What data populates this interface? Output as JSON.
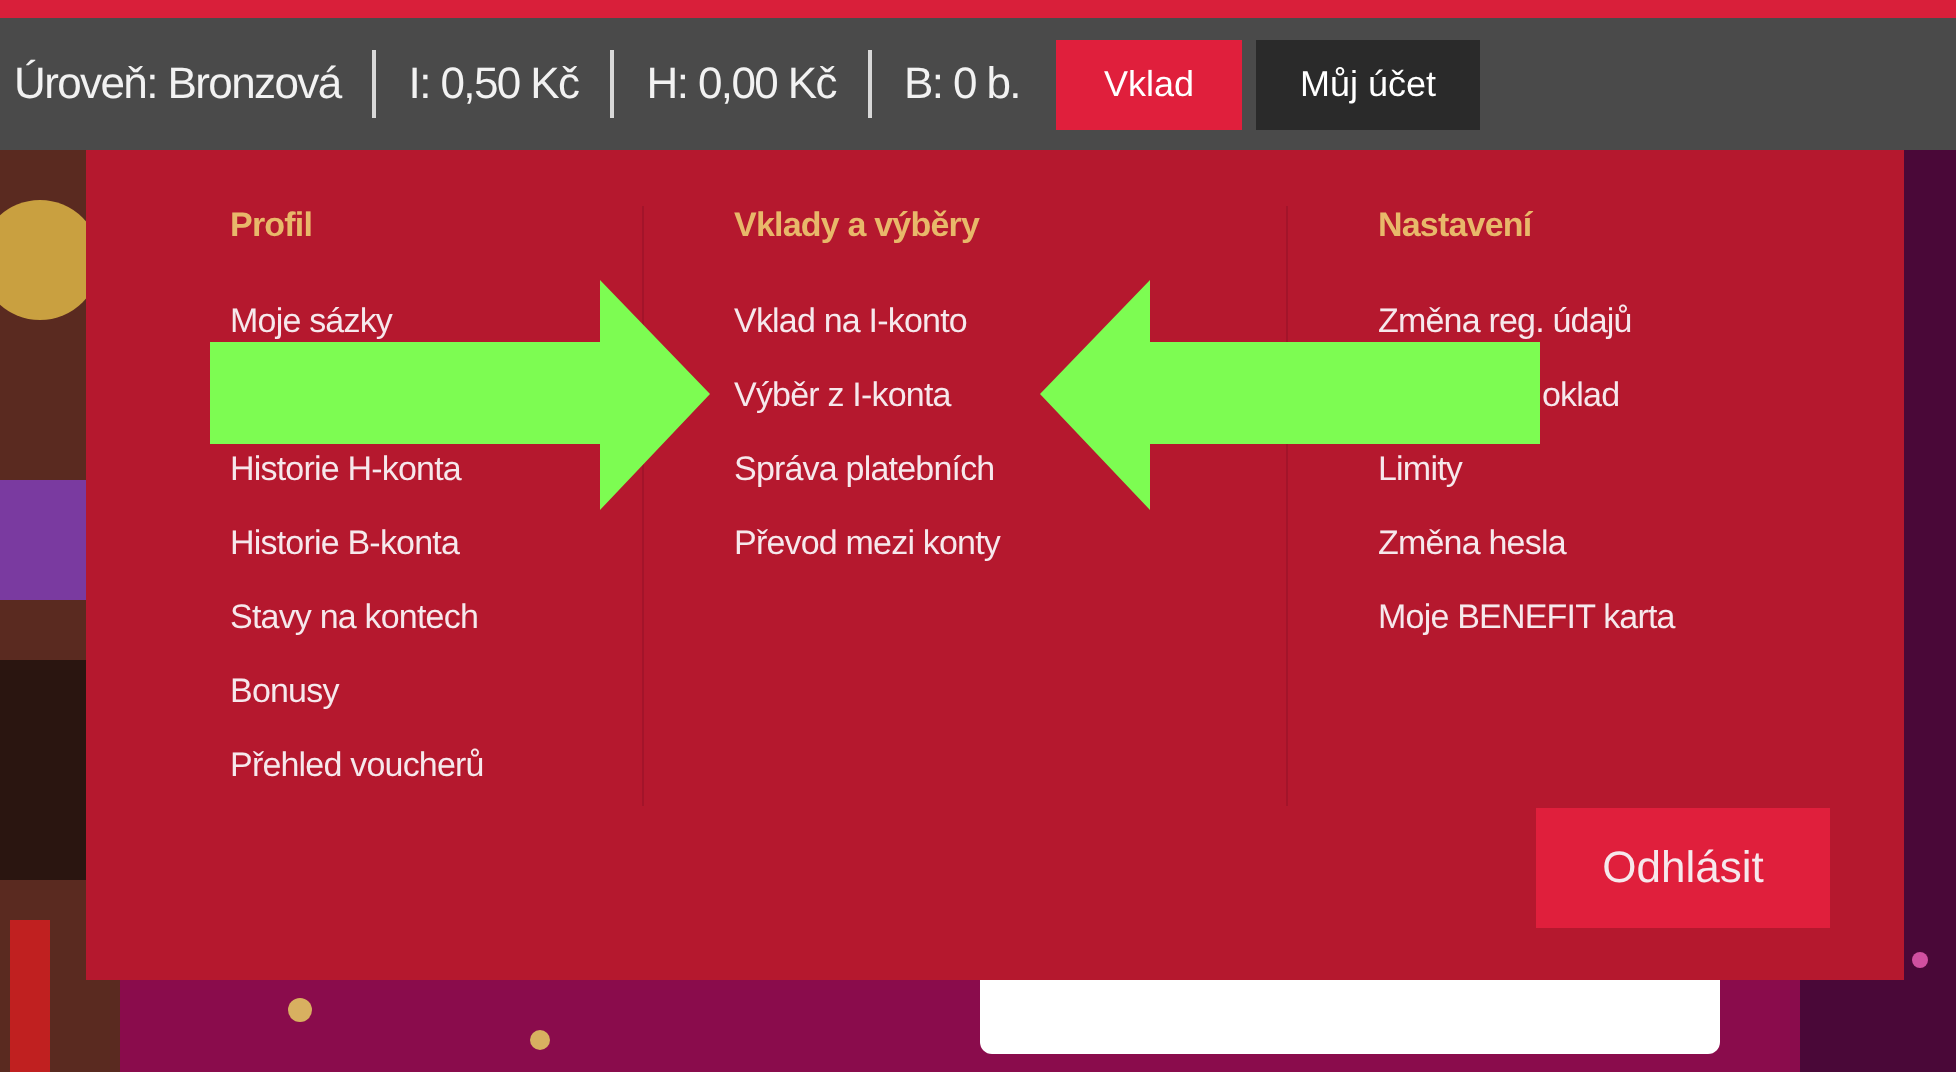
{
  "top_bar": {
    "stats": [
      {
        "text": "Úroveň: Bronzová"
      },
      {
        "text": "I: 0,50 Kč"
      },
      {
        "text": "H: 0,00 Kč"
      },
      {
        "text": "B: 0 b."
      }
    ],
    "buttons": [
      {
        "label": "Vklad",
        "kind": "primary"
      },
      {
        "label": "Můj účet",
        "kind": "dark"
      }
    ]
  },
  "account_menu": {
    "columns": [
      {
        "heading": "Profil",
        "items": [
          {
            "label": "Moje sázky"
          },
          {
            "kind": "hidden"
          },
          {
            "label": "Historie H-konta"
          },
          {
            "label": "Historie B-konta"
          },
          {
            "label": "Stavy na kontech"
          },
          {
            "label": "Bonusy"
          },
          {
            "label": "Přehled voucherů"
          }
        ]
      },
      {
        "heading": "Vklady a výběry",
        "items": [
          {
            "label": "Vklad na I-konto"
          },
          {
            "label": "Výběr z I-konta"
          },
          {
            "label": "Správa platebních"
          },
          {
            "label": "Převod mezi konty"
          }
        ]
      },
      {
        "heading": "Nastavení",
        "items": [
          {
            "label": "Změna reg. údajů"
          },
          {
            "label": "oklad",
            "kind": "partial"
          },
          {
            "label": "Limity"
          },
          {
            "label": "Změna hesla"
          },
          {
            "label": "Moje BENEFIT karta"
          }
        ]
      }
    ],
    "logout_button": {
      "label": "Odhlásit"
    }
  },
  "annotations": [
    {
      "kind": "arrow-right"
    },
    {
      "kind": "arrow-left"
    }
  ]
}
